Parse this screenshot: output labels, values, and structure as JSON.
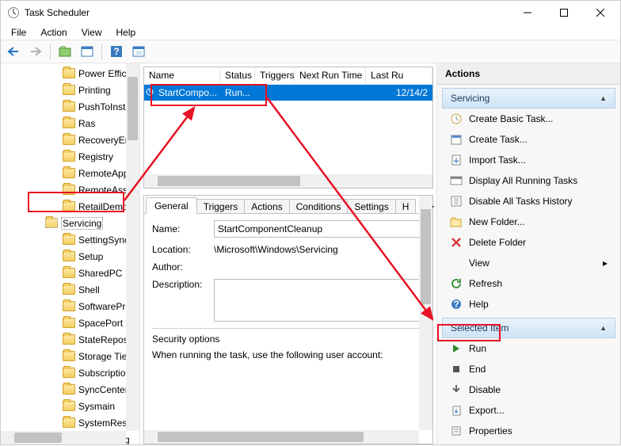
{
  "window": {
    "title": "Task Scheduler"
  },
  "menu": [
    "File",
    "Action",
    "View",
    "Help"
  ],
  "tree": {
    "items": [
      "Power Effic",
      "Printing",
      "PushToInsta",
      "Ras",
      "RecoveryEn",
      "Registry",
      "RemoteApp",
      "RemoteAss",
      "RetailDemo",
      "Servicing",
      "SettingSync",
      "Setup",
      "SharedPC",
      "Shell",
      "SoftwarePr",
      "SpacePort",
      "StateReposi",
      "Storage Tie",
      "Subscriptio",
      "SyncCenter",
      "Sysmain",
      "SystemRest",
      "Task Manag"
    ],
    "selected_index": 9
  },
  "list": {
    "columns": [
      "Name",
      "Status",
      "Triggers",
      "Next Run Time",
      "Last Ru"
    ],
    "row": {
      "name": "StartCompo...",
      "status": "Run...",
      "next": "12/14/2"
    }
  },
  "tabs": [
    "General",
    "Triggers",
    "Actions",
    "Conditions",
    "Settings",
    "H"
  ],
  "form": {
    "name_lbl": "Name:",
    "name_val": "StartComponentCleanup",
    "loc_lbl": "Location:",
    "loc_val": "\\Microsoft\\Windows\\Servicing",
    "auth_lbl": "Author:",
    "desc_lbl": "Description:",
    "sec_head": "Security options",
    "sec_line": "When running the task, use the following user account:"
  },
  "actions": {
    "header": "Actions",
    "section1": "Servicing",
    "items1": [
      "Create Basic Task...",
      "Create Task...",
      "Import Task...",
      "Display All Running Tasks",
      "Disable All Tasks History",
      "New Folder...",
      "Delete Folder",
      "View",
      "Refresh",
      "Help"
    ],
    "section2": "Selected Item",
    "items2": [
      "Run",
      "End",
      "Disable",
      "Export...",
      "Properties"
    ]
  }
}
